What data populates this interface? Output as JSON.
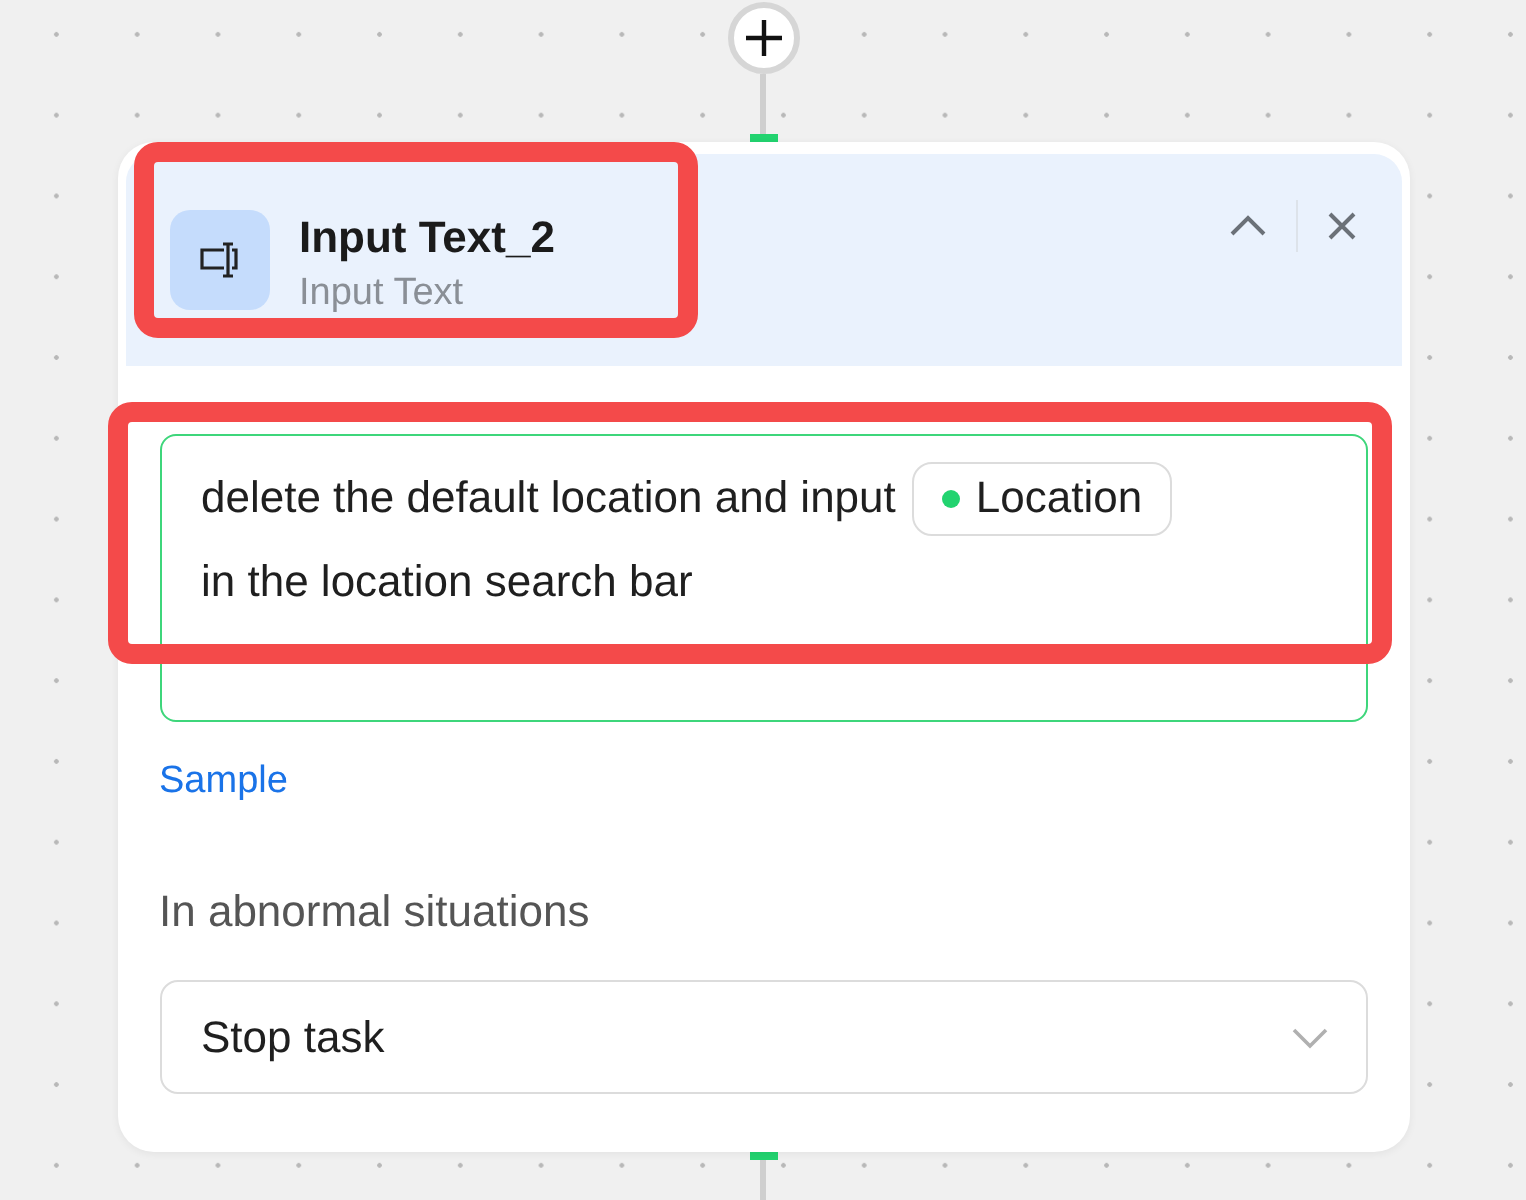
{
  "node": {
    "title": "Input Text_2",
    "type_label": "Input Text",
    "highlighted": true
  },
  "instruction": {
    "highlighted": true,
    "segments": [
      {
        "kind": "text",
        "text": "delete the default location and input"
      },
      {
        "kind": "variable",
        "text": "Location",
        "color": "#22d36f"
      },
      {
        "kind": "text",
        "text": "in the location search bar"
      }
    ]
  },
  "sample_link": "Sample",
  "abnormal": {
    "label": "In abnormal situations",
    "value": "Stop task"
  }
}
